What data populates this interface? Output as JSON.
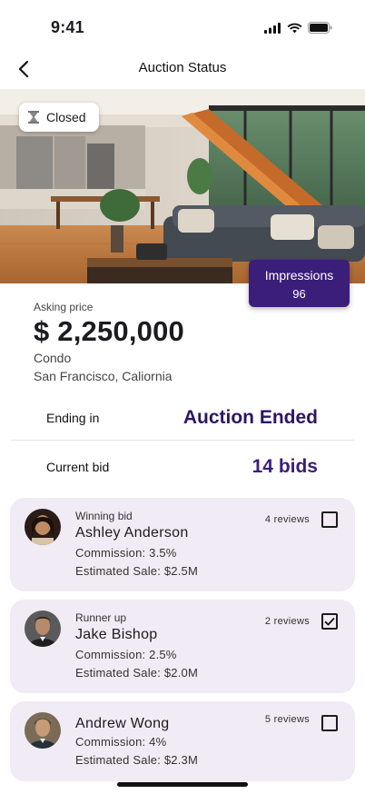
{
  "status_bar": {
    "time": "9:41"
  },
  "nav": {
    "title": "Auction Status"
  },
  "listing": {
    "status_badge": "Closed",
    "impressions_label": "Impressions",
    "impressions_value": "96",
    "asking_label": "Asking price",
    "asking_price": "$ 2,250,000",
    "type": "Condo",
    "location": "San Francisco, Caliornia"
  },
  "auction": {
    "ending_label": "Ending in",
    "ending_value": "Auction Ended",
    "bid_label": "Current bid",
    "bid_value": "14 bids"
  },
  "bidders": [
    {
      "role": "Winning bid",
      "name": "Ashley Anderson",
      "commission": "Commission: 3.5%",
      "estimate": "Estimated Sale: $2.5M",
      "reviews": "4 reviews",
      "checked": false
    },
    {
      "role": "Runner up",
      "name": "Jake Bishop",
      "commission": "Commission: 2.5%",
      "estimate": "Estimated Sale: $2.0M",
      "reviews": "2 reviews",
      "checked": true
    },
    {
      "role": "",
      "name": "Andrew Wong",
      "commission": "Commission: 4%",
      "estimate": "Estimated Sale: $2.3M",
      "reviews": "5 reviews",
      "checked": false
    }
  ],
  "colors": {
    "accent": "#3b1d7a",
    "ended": "#2e1565",
    "card_bg": "#f0ebf4"
  },
  "icons": {
    "back": "chevron-left-icon",
    "hourglass": "hourglass-icon",
    "signal": "cellular-signal-icon",
    "wifi": "wifi-icon",
    "battery": "battery-icon"
  }
}
